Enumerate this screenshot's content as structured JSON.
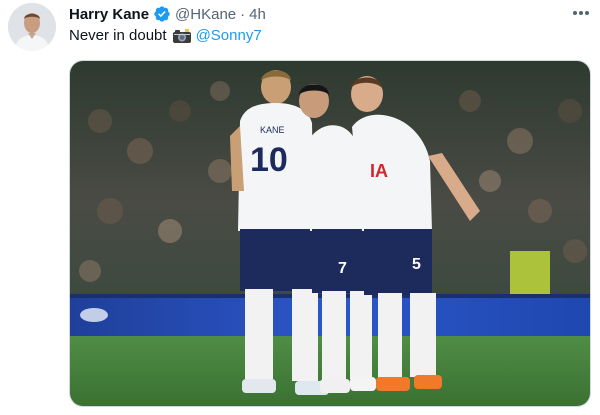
{
  "tweet": {
    "author": {
      "display_name": "Harry Kane",
      "handle": "@HKane",
      "verified": true,
      "avatar_icon": "profile-photo"
    },
    "separator": "·",
    "time": "4h",
    "text": "Never in doubt",
    "emoji_icon": "camera-with-flash-icon",
    "mention": "@Sonny7",
    "more_icon": "more-dots-icon",
    "media": {
      "description_icon": "photo",
      "players": [
        {
          "name_on_shirt": "KANE",
          "number": "10"
        },
        {
          "name_on_shirt": "",
          "number": "7"
        },
        {
          "name_on_shirt": "",
          "number": "5"
        }
      ],
      "shirt_sponsor": "IA"
    }
  },
  "colors": {
    "link": "#1d9bf0",
    "verified": "#1d9bf0",
    "muted_text": "#536471",
    "kit_shorts": "#1c2a5c",
    "pitch": "#3f7d3a"
  }
}
